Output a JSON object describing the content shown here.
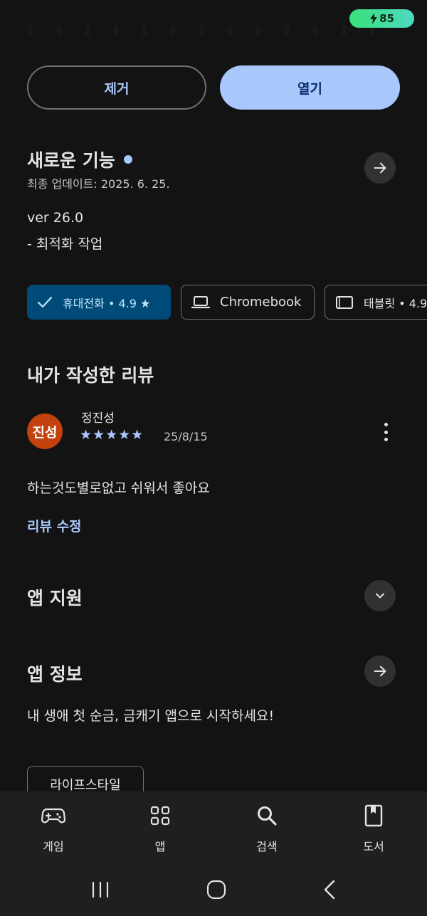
{
  "status": {
    "battery": "85"
  },
  "actions": {
    "uninstall_label": "제거",
    "open_label": "열기"
  },
  "whats_new": {
    "title": "새로운 기능",
    "updated": "최종 업데이트: 2025. 6. 25.",
    "version": "ver 26.0",
    "note": "- 최적화 작업"
  },
  "devices": [
    {
      "label": "휴대전화 • 4.9 ★",
      "icon": "check-icon",
      "selected": true
    },
    {
      "label": "Chromebook",
      "icon": "laptop-icon",
      "selected": false
    },
    {
      "label": "태블릿 • 4.9",
      "icon": "tablet-icon",
      "selected": false
    }
  ],
  "my_review": {
    "title": "내가 작성한 리뷰",
    "avatar_text": "진성",
    "reviewer": "정진성",
    "stars": "★★★★★",
    "rating": 5,
    "date": "25/8/15",
    "text": "하는것도별로없고 쉬워서 좋아요",
    "edit_label": "리뷰 수정"
  },
  "app_support": {
    "title": "앱 지원"
  },
  "app_info": {
    "title": "앱 정보",
    "description": "내 생애 첫 순금, 금캐기 앱으로 시작하세요!"
  },
  "tags": [
    "라이프스타일"
  ],
  "bottom_nav": [
    {
      "label": "게임",
      "icon": "gamepad-icon"
    },
    {
      "label": "앱",
      "icon": "apps-grid-icon"
    },
    {
      "label": "검색",
      "icon": "search-icon"
    },
    {
      "label": "도서",
      "icon": "book-icon"
    }
  ],
  "colors": {
    "background": "#131314",
    "accent": "#a8c7fa",
    "selected_chip": "#004a77",
    "avatar": "#c2410c",
    "battery": "#39e07a"
  }
}
